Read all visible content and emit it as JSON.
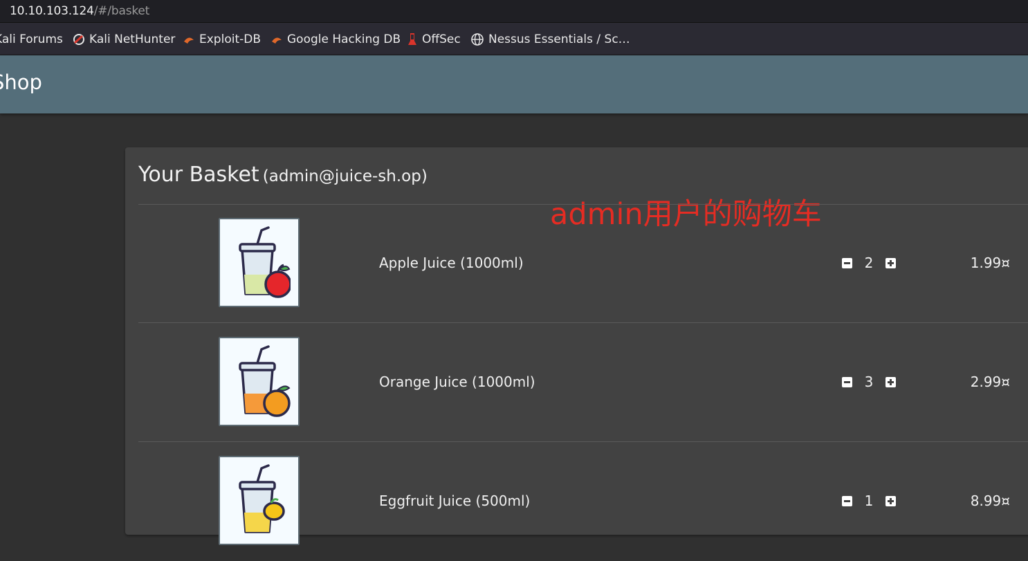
{
  "browser": {
    "url_host": "10.10.103.124",
    "url_path": "/#/basket"
  },
  "bookmarks": [
    {
      "label": "Kali Forums",
      "icon": "none"
    },
    {
      "label": "Kali NetHunter",
      "icon": "nethunter-icon"
    },
    {
      "label": "Exploit-DB",
      "icon": "exploit-db-icon"
    },
    {
      "label": "Google Hacking DB",
      "icon": "ghdb-icon"
    },
    {
      "label": "OffSec",
      "icon": "offsec-icon"
    },
    {
      "label": "Nessus Essentials / Sc…",
      "icon": "globe-icon"
    }
  ],
  "app": {
    "title": "Shop"
  },
  "basket": {
    "title": "Your Basket",
    "user": "(admin@juice-sh.op)",
    "annotation": "admin用户的购物车",
    "items": [
      {
        "name": "Apple Juice (1000ml)",
        "quantity": "2",
        "price": "1.99¤",
        "fruit": "apple"
      },
      {
        "name": "Orange Juice (1000ml)",
        "quantity": "3",
        "price": "2.99¤",
        "fruit": "orange"
      },
      {
        "name": "Eggfruit Juice (500ml)",
        "quantity": "1",
        "price": "8.99¤",
        "fruit": "eggfruit"
      }
    ]
  },
  "colors": {
    "toolbar": "#546e7a",
    "card": "#424242",
    "background": "#303030",
    "annotation": "#e52c23"
  }
}
